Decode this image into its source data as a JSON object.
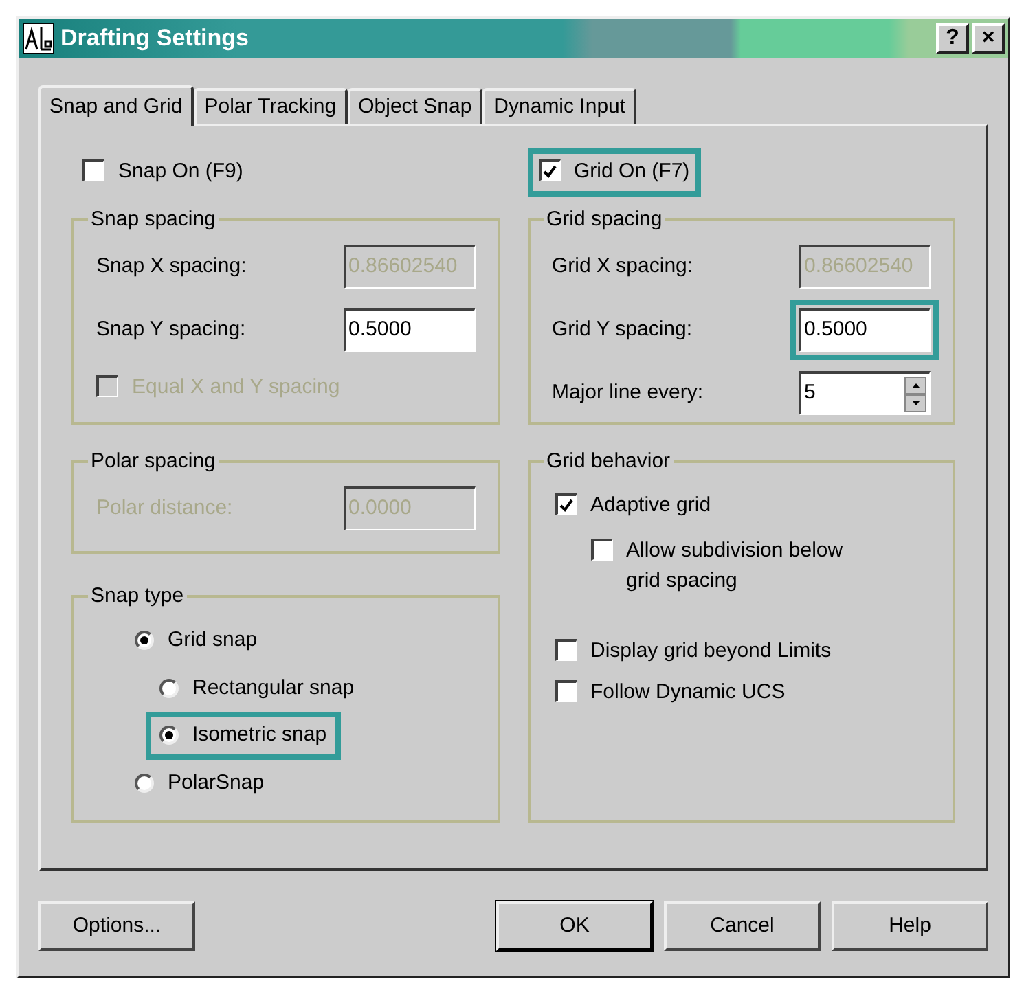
{
  "window": {
    "title": "Drafting Settings",
    "controls": [
      "?",
      "×"
    ]
  },
  "tabs": [
    {
      "label": "Snap and Grid",
      "selected": true
    },
    {
      "label": "Polar Tracking",
      "selected": false
    },
    {
      "label": "Object Snap",
      "selected": false
    },
    {
      "label": "Dynamic Input",
      "selected": false
    }
  ],
  "snap_on": {
    "label": "Snap On (F9)",
    "checked": false
  },
  "grid_on": {
    "label": "Grid On (F7)",
    "checked": true,
    "highlighted": true
  },
  "snap_spacing": {
    "title": "Snap spacing",
    "fields": [
      {
        "label": "Snap X spacing:",
        "value": "0.86602540",
        "disabled": true,
        "kind": "text"
      },
      {
        "label": "Snap Y spacing:",
        "value": "0.5000",
        "disabled": false,
        "kind": "text"
      }
    ],
    "equal": {
      "label": "Equal X and Y spacing",
      "checked": false,
      "disabled": true
    }
  },
  "polar_spacing": {
    "title": "Polar spacing",
    "fields": [
      {
        "label": "Polar distance:",
        "value": "0.0000",
        "disabled": true,
        "kind": "text"
      }
    ]
  },
  "snap_type": {
    "title": "Snap type",
    "options": [
      {
        "label": "Grid snap",
        "selected": true,
        "highlighted": false,
        "children": [
          {
            "label": "Rectangular snap",
            "selected": false,
            "highlighted": false
          },
          {
            "label": "Isometric snap",
            "selected": true,
            "highlighted": true
          }
        ]
      },
      {
        "label": "PolarSnap",
        "selected": false,
        "highlighted": false
      }
    ]
  },
  "grid_spacing": {
    "title": "Grid spacing",
    "fields": [
      {
        "label": "Grid X spacing:",
        "value": "0.86602540",
        "disabled": true,
        "highlighted": false,
        "kind": "text"
      },
      {
        "label": "Grid Y spacing:",
        "value": "0.5000",
        "disabled": false,
        "highlighted": true,
        "kind": "text"
      },
      {
        "label": "Major line every:",
        "value": "5",
        "disabled": false,
        "highlighted": false,
        "kind": "spinner"
      }
    ]
  },
  "grid_behavior": {
    "title": "Grid behavior",
    "options": [
      {
        "label": "Adaptive grid",
        "checked": true,
        "children": [
          {
            "label": "Allow subdivision below grid spacing",
            "checked": false
          }
        ]
      },
      {
        "label": "Display grid beyond Limits",
        "checked": false
      },
      {
        "label": "Follow Dynamic UCS",
        "checked": false
      }
    ]
  },
  "buttons": [
    {
      "label": "Options...",
      "default": false
    },
    {
      "label": "OK",
      "default": true
    },
    {
      "label": "Cancel",
      "default": false
    },
    {
      "label": "Help",
      "default": false
    }
  ]
}
